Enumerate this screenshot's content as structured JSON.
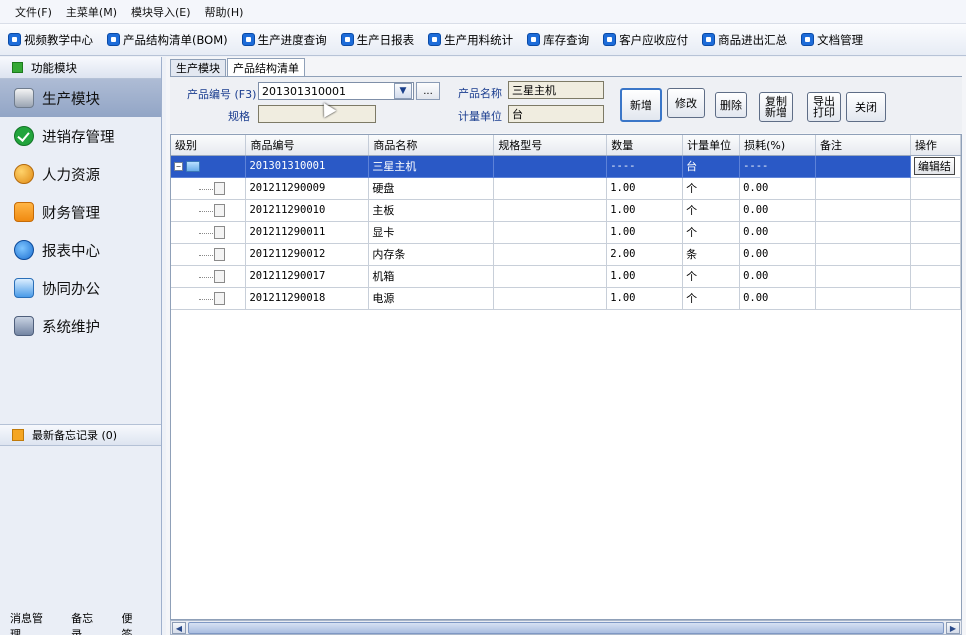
{
  "menu": [
    "文件(F)",
    "主菜单(M)",
    "模块导入(E)",
    "帮助(H)"
  ],
  "toolbar": [
    "视频教学中心",
    "产品结构清单(BOM)",
    "生产进度查询",
    "生产日报表",
    "生产用料统计",
    "库存查询",
    "客户应收应付",
    "商品进出汇总",
    "文档管理"
  ],
  "sidebar": {
    "header": "功能模块",
    "items": [
      {
        "label": "生产模块",
        "icon": "production-icon",
        "active": true
      },
      {
        "label": "进销存管理",
        "icon": "checkmark-icon",
        "active": false
      },
      {
        "label": "人力资源",
        "icon": "people-icon",
        "active": false
      },
      {
        "label": "财务管理",
        "icon": "folder-icon",
        "active": false
      },
      {
        "label": "报表中心",
        "icon": "report-icon",
        "active": false
      },
      {
        "label": "协同办公",
        "icon": "calendar-icon",
        "active": false
      },
      {
        "label": "系统维护",
        "icon": "lock-icon",
        "active": false
      }
    ],
    "memo": "最新备忘记录 (0)",
    "footer": [
      "消息管理",
      "备忘录",
      "便签"
    ]
  },
  "tabs": [
    "生产模块",
    "产品结构清单"
  ],
  "form": {
    "product_code_label": "产品编号 (F3)",
    "product_code_value": "201301310001",
    "dots": "...",
    "product_name_label": "产品名称",
    "product_name_value": "三星主机",
    "spec_label": "规格",
    "spec_value": "",
    "unit_label": "计量单位",
    "unit_value": "台"
  },
  "buttons": {
    "add": "新增",
    "edit": "修改",
    "delete": "删除",
    "copy_add": "复制\n新增",
    "export_print": "导出\n打印",
    "close": "关闭"
  },
  "table": {
    "columns": [
      "级别",
      "商品编号",
      "商品名称",
      "规格型号",
      "数量",
      "计量单位",
      "损耗(%)",
      "备注",
      "操作"
    ],
    "rows": [
      {
        "code": "201301310001",
        "name": "三星主机",
        "spec": "",
        "qty": "----",
        "unit": "台",
        "loss": "----",
        "remark": "",
        "op": "编辑结",
        "root": true
      },
      {
        "code": "201211290009",
        "name": "硬盘",
        "spec": "",
        "qty": "1.00",
        "unit": "个",
        "loss": "0.00",
        "remark": "",
        "op": ""
      },
      {
        "code": "201211290010",
        "name": "主板",
        "spec": "",
        "qty": "1.00",
        "unit": "个",
        "loss": "0.00",
        "remark": "",
        "op": ""
      },
      {
        "code": "201211290011",
        "name": "显卡",
        "spec": "",
        "qty": "1.00",
        "unit": "个",
        "loss": "0.00",
        "remark": "",
        "op": ""
      },
      {
        "code": "201211290012",
        "name": "内存条",
        "spec": "",
        "qty": "2.00",
        "unit": "条",
        "loss": "0.00",
        "remark": "",
        "op": ""
      },
      {
        "code": "201211290017",
        "name": "机箱",
        "spec": "",
        "qty": "1.00",
        "unit": "个",
        "loss": "0.00",
        "remark": "",
        "op": ""
      },
      {
        "code": "201211290018",
        "name": "电源",
        "spec": "",
        "qty": "1.00",
        "unit": "个",
        "loss": "0.00",
        "remark": "",
        "op": ""
      }
    ]
  },
  "colors": {
    "selection": "#2a59c6",
    "active_nav": "#92a5c6",
    "accent": "#1d6cd9"
  }
}
